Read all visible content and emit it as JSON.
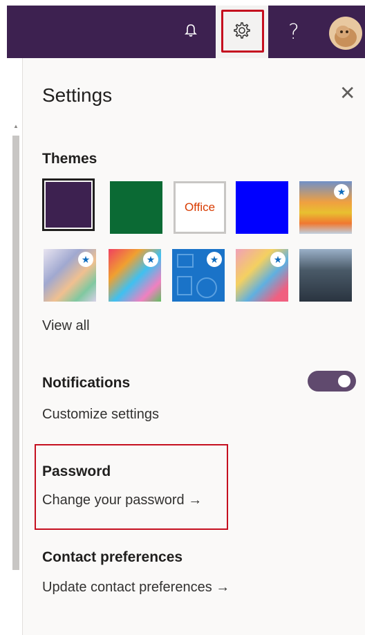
{
  "topbar": {
    "bell_icon": "bell-icon",
    "gear_icon": "gear-icon",
    "help_label": "?",
    "avatar": "user-avatar"
  },
  "settings": {
    "title": "Settings",
    "close_label": "✕",
    "themes": {
      "heading": "Themes",
      "items": [
        {
          "label": "",
          "color": "#3d2150",
          "selected": true,
          "starred": false
        },
        {
          "label": "",
          "color": "#0b6a34",
          "selected": false,
          "starred": false
        },
        {
          "label": "Office",
          "color": "#ffffff",
          "selected": false,
          "starred": false
        },
        {
          "label": "",
          "color": "#0000ff",
          "selected": false,
          "starred": false
        },
        {
          "label": "",
          "color": "#f0a040",
          "selected": false,
          "starred": true
        },
        {
          "label": "",
          "color": "#c8c4d8",
          "selected": false,
          "starred": true
        },
        {
          "label": "",
          "color": "#f08040",
          "selected": false,
          "starred": true
        },
        {
          "label": "",
          "color": "#1a73c8",
          "selected": false,
          "starred": true
        },
        {
          "label": "",
          "color": "#f080a0",
          "selected": false,
          "starred": true
        },
        {
          "label": "",
          "color": "#3a4a58",
          "selected": false,
          "starred": false
        }
      ],
      "view_all": "View all"
    },
    "notifications": {
      "heading": "Notifications",
      "link": "Customize settings",
      "toggle_on": true
    },
    "password": {
      "heading": "Password",
      "link": "Change your password →"
    },
    "contact": {
      "heading": "Contact preferences",
      "link": "Update contact preferences →"
    }
  },
  "colors": {
    "topbar": "#3d2150",
    "highlight": "#c50f1f",
    "panel_bg": "#faf9f8"
  }
}
